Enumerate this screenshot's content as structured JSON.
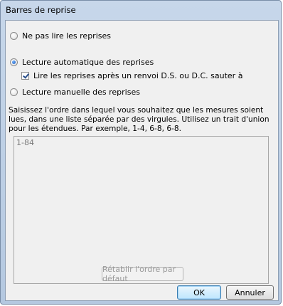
{
  "window": {
    "title": "Barres de reprise"
  },
  "options": {
    "no_repeats": {
      "label": "Ne pas lire les reprises",
      "selected": false
    },
    "auto_repeats": {
      "label": "Lecture automatique des reprises",
      "selected": true
    },
    "ds_dc": {
      "label": "Lire les reprises après un renvoi D.S. ou D.C. sauter à",
      "checked": true
    },
    "manual_repeats": {
      "label": "Lecture manuelle des reprises",
      "selected": false
    }
  },
  "instructions": "Saisissez l'ordre dans lequel vous souhaitez que les mesures soient lues, dans une liste séparée par des virgules. Utilisez un trait d'union pour les étendues. Par exemple, 1-4, 6-8, 6-8.",
  "order_field": {
    "value": "1-84"
  },
  "buttons": {
    "reset": "Rétablir l'ordre par défaut",
    "ok": "OK",
    "cancel": "Annuler"
  }
}
